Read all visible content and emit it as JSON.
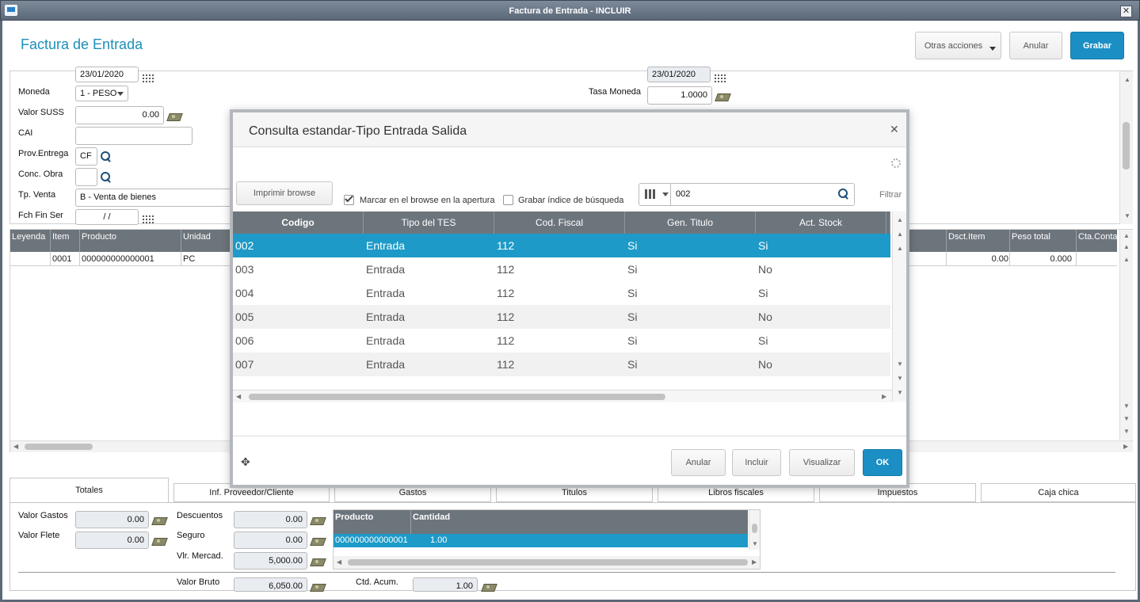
{
  "window": {
    "title": "Factura de Entrada - INCLUIR",
    "close_glyph": "✕"
  },
  "page": {
    "title": "Factura de Entrada"
  },
  "toolbar": {
    "other_actions": "Otras acciones",
    "cancel": "Anular",
    "save": "Grabar"
  },
  "form": {
    "date_left": "23/01/2020",
    "date_right": "23/01/2020",
    "moneda_label": "Moneda",
    "moneda_value": "1 - PESO",
    "valor_suss_label": "Valor SUSS",
    "valor_suss_value": "0.00",
    "cai_label": "CAI",
    "prov_entrega_label": "Prov.Entrega",
    "prov_entrega_value": "CF",
    "conc_obra_label": "Conc. Obra",
    "tp_venta_label": "Tp. Venta",
    "tp_venta_value": "B - Venta de bienes",
    "fch_fin_ser_label": "Fch Fin Ser",
    "fch_fin_ser_value": "/ /",
    "tasa_moneda_label": "Tasa Moneda",
    "tasa_moneda_value": "1.0000"
  },
  "items_grid": {
    "headers": {
      "leyenda": "Leyenda",
      "item": "Item",
      "producto": "Producto",
      "unidad": "Unidad",
      "dsct_item": "Dsct.Item",
      "peso_total": "Peso total",
      "cta_contab": "Cta.Contab"
    },
    "row": {
      "item": "0001",
      "producto": "000000000000001",
      "unidad": "PC",
      "dsct_item": "0.00",
      "peso_total": "0.000"
    }
  },
  "tabs": {
    "totales": "Totales",
    "inf_proveedor": "Inf. Proveedor/Cliente",
    "gastos": "Gastos",
    "titulos": "Titulos",
    "libros": "Libros fiscales",
    "impuestos": "Impuestos",
    "caja": "Caja chica"
  },
  "totals": {
    "valor_gastos_label": "Valor Gastos",
    "valor_gastos": "0.00",
    "valor_flete_label": "Valor Flete",
    "valor_flete": "0.00",
    "descuentos_label": "Descuentos",
    "descuentos": "0.00",
    "seguro_label": "Seguro",
    "seguro": "0.00",
    "vlr_mercad_label": "Vlr. Mercad.",
    "vlr_mercad": "5,000.00",
    "valor_bruto_label": "Valor Bruto",
    "valor_bruto": "6,050.00",
    "ctd_acum_label": "Ctd. Acum.",
    "ctd_acum": "1.00",
    "mini_grid": {
      "producto": "Producto",
      "cantidad": "Cantidad",
      "row_producto": "000000000000001",
      "row_cantidad": "1.00"
    }
  },
  "dialog": {
    "title": "Consulta estandar-Tipo Entrada Salida",
    "close_glyph": "✕",
    "print_button": "Imprimir browse",
    "check_mark_label": "Marcar en el browse en la apertura",
    "check_index_label": "Grabar índice de búsqueda",
    "search_value": "002",
    "filter_label": "Filtrar",
    "columns": [
      "Codigo",
      "Tipo del TES",
      "Cod. Fiscal",
      "Gen. Titulo",
      "Act. Stock"
    ],
    "rows": [
      [
        "002",
        "Entrada",
        "112",
        "Si",
        "Si"
      ],
      [
        "003",
        "Entrada",
        "112",
        "Si",
        "No"
      ],
      [
        "004",
        "Entrada",
        "112",
        "Si",
        "Si"
      ],
      [
        "005",
        "Entrada",
        "112",
        "Si",
        "No"
      ],
      [
        "006",
        "Entrada",
        "112",
        "Si",
        "Si"
      ],
      [
        "007",
        "Entrada",
        "112",
        "Si",
        "No"
      ]
    ],
    "buttons": {
      "cancel": "Anular",
      "include": "Incluir",
      "view": "Visualizar",
      "ok": "OK"
    }
  },
  "colors": {
    "accent": "#1b8fc4",
    "selected_row": "#1d9ac7",
    "header_gray": "#6d757c"
  }
}
